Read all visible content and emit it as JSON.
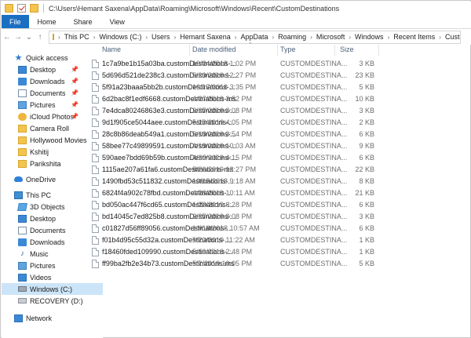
{
  "window": {
    "title": "C:\\Users\\Hemant Saxena\\AppData\\Roaming\\Microsoft\\Windows\\Recent\\CustomDestinations"
  },
  "ribbon": {
    "tabs": [
      "File",
      "Home",
      "Share",
      "View"
    ]
  },
  "address": {
    "crumbs": [
      "This PC",
      "Windows (C:)",
      "Users",
      "Hemant Saxena",
      "AppData",
      "Roaming",
      "Microsoft",
      "Windows",
      "Recent Items",
      "CustomDestinations"
    ]
  },
  "sidebar": {
    "items": [
      {
        "label": "Quick access",
        "icon": "star-icon"
      },
      {
        "label": "Desktop",
        "icon": "desktop-icon"
      },
      {
        "label": "Downloads",
        "icon": "downloads-icon"
      },
      {
        "label": "Documents",
        "icon": "documents-icon"
      },
      {
        "label": "Pictures",
        "icon": "pictures-icon"
      },
      {
        "label": "iCloud Photos",
        "icon": "icloud-icon"
      },
      {
        "label": "Camera Roll",
        "icon": "folder-icon"
      },
      {
        "label": "Hollywood Movies",
        "icon": "folder-icon"
      },
      {
        "label": "Kshitij",
        "icon": "folder-icon"
      },
      {
        "label": "Parikshita",
        "icon": "folder-icon"
      },
      {
        "label": "OneDrive",
        "icon": "onedrive-icon"
      },
      {
        "label": "This PC",
        "icon": "pc-icon"
      },
      {
        "label": "3D Objects",
        "icon": "3d-objects-icon"
      },
      {
        "label": "Desktop",
        "icon": "desktop-icon"
      },
      {
        "label": "Documents",
        "icon": "documents-icon"
      },
      {
        "label": "Downloads",
        "icon": "downloads-icon"
      },
      {
        "label": "Music",
        "icon": "music-icon"
      },
      {
        "label": "Pictures",
        "icon": "pictures-icon"
      },
      {
        "label": "Videos",
        "icon": "videos-icon"
      },
      {
        "label": "Windows (C:)",
        "icon": "drive-icon"
      },
      {
        "label": "RECOVERY (D:)",
        "icon": "drive-icon"
      },
      {
        "label": "Network",
        "icon": "network-icon"
      }
    ]
  },
  "columns": {
    "name": "Name",
    "date": "Date modified",
    "type": "Type",
    "size": "Size"
  },
  "files": [
    {
      "name": "1c7a9be1b15a03ba.customDestinations-...",
      "date": "10/24/2018 1:02 PM",
      "type": "CUSTOMDESTINA...",
      "size": "3 KB"
    },
    {
      "name": "5d696d521de238c3.customDestinations-...",
      "date": "5/20/2019 12:27 PM",
      "type": "CUSTOMDESTINA...",
      "size": "23 KB"
    },
    {
      "name": "5f91a23baaa5bb2b.customDestinations-...",
      "date": "10/17/2018 3:35 PM",
      "type": "CUSTOMDESTINA...",
      "size": "5 KB"
    },
    {
      "name": "6d2bac8f1edf6668.customDestinations-ms",
      "date": "4/27/2019 3:52 PM",
      "type": "CUSTOMDESTINA...",
      "size": "10 KB"
    },
    {
      "name": "7e4dca80246863e3.customDestinations-...",
      "date": "2/27/2019 3:08 PM",
      "type": "CUSTOMDESTINA...",
      "size": "3 KB"
    },
    {
      "name": "9d1f905ce5044aee.customDestinations-...",
      "date": "5/13/2019 4:05 PM",
      "type": "CUSTOMDESTINA...",
      "size": "2 KB"
    },
    {
      "name": "28c8b86deab549a1.customDestinations-...",
      "date": "5/13/2019 3:54 PM",
      "type": "CUSTOMDESTINA...",
      "size": "6 KB"
    },
    {
      "name": "58bee77c49899591.customDestinations-...",
      "date": "4/18/2019 10:03 AM",
      "type": "CUSTOMDESTINA...",
      "size": "9 KB"
    },
    {
      "name": "590aee7bdd69b59b.customDestinations-...",
      "date": "4/20/2019 4:15 PM",
      "type": "CUSTOMDESTINA...",
      "size": "6 KB"
    },
    {
      "name": "1115ae207a61fa6.customDestinations-ms",
      "date": "5/20/2019 12:27 PM",
      "type": "CUSTOMDESTINA...",
      "size": "22 KB"
    },
    {
      "name": "1490fbd53c511832.customDestinations-...",
      "date": "10/15/2018 9:18 AM",
      "type": "CUSTOMDESTINA...",
      "size": "8 KB"
    },
    {
      "name": "6824f4a902c78fbd.customDestinations-...",
      "date": "4/28/2019 10:11 AM",
      "type": "CUSTOMDESTINA...",
      "size": "21 KB"
    },
    {
      "name": "bd050ac447f6cd65.customDestinations-...",
      "date": "1/23/2019 8:28 PM",
      "type": "CUSTOMDESTINA...",
      "size": "6 KB"
    },
    {
      "name": "bd14045c7ed825b8.customDestinations-...",
      "date": "2/27/2019 3:08 PM",
      "type": "CUSTOMDESTINA...",
      "size": "3 KB"
    },
    {
      "name": "c01827d56ff89056.customDestinations-...",
      "date": "10/18/2018 10:57 AM",
      "type": "CUSTOMDESTINA...",
      "size": "6 KB"
    },
    {
      "name": "f01b4d95c55d32a.customDestinations-...",
      "date": "5/20/2019 11:22 AM",
      "type": "CUSTOMDESTINA...",
      "size": "1 KB"
    },
    {
      "name": "f18460fded109990.customDestinations-...",
      "date": "5/19/2019 2:48 PM",
      "type": "CUSTOMDESTINA...",
      "size": "1 KB"
    },
    {
      "name": "ff99ba2fb2e34b73.customDestinations-ms",
      "date": "5/2/2019 10:05 PM",
      "type": "CUSTOMDESTINA...",
      "size": "5 KB"
    }
  ]
}
